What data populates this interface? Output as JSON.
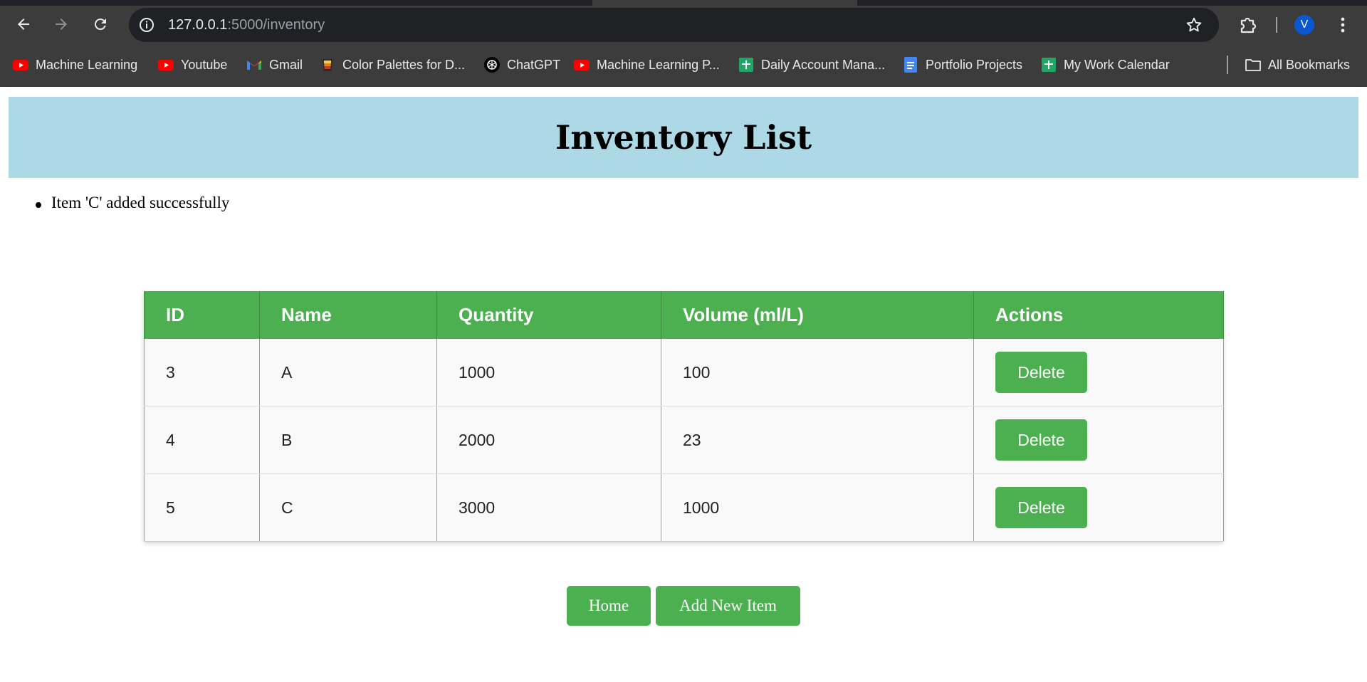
{
  "browser": {
    "url_host": "127.0.0.1",
    "url_path": ":5000/inventory",
    "avatar_letter": "V",
    "bookmarks": [
      {
        "label": "Machine Learning",
        "icon": "youtube-icon"
      },
      {
        "label": "Youtube",
        "icon": "youtube-icon"
      },
      {
        "label": "Gmail",
        "icon": "gmail-icon"
      },
      {
        "label": "Color Palettes for D...",
        "icon": "palette-icon"
      },
      {
        "label": "ChatGPT",
        "icon": "chatgpt-icon"
      },
      {
        "label": "Machine Learning P...",
        "icon": "youtube-icon"
      },
      {
        "label": "Daily Account Mana...",
        "icon": "sheets-icon"
      },
      {
        "label": "Portfolio Projects",
        "icon": "docs-icon"
      },
      {
        "label": "My Work Calendar",
        "icon": "sheets-icon"
      }
    ],
    "all_bookmarks": "All Bookmarks"
  },
  "page": {
    "title": "Inventory List",
    "flash_messages": [
      "Item 'C' added successfully"
    ]
  },
  "table": {
    "headers": [
      "ID",
      "Name",
      "Quantity",
      "Volume (ml/L)",
      "Actions"
    ],
    "rows": [
      {
        "id": "3",
        "name": "A",
        "quantity": "1000",
        "volume": "100",
        "action": "Delete"
      },
      {
        "id": "4",
        "name": "B",
        "quantity": "2000",
        "volume": "23",
        "action": "Delete"
      },
      {
        "id": "5",
        "name": "C",
        "quantity": "3000",
        "volume": "1000",
        "action": "Delete"
      }
    ]
  },
  "buttons": {
    "home": "Home",
    "add_new": "Add New Item"
  },
  "colors": {
    "header_bg": "#add8e6",
    "accent_green": "#4caf50",
    "chrome_bg": "#3c3c3c"
  }
}
